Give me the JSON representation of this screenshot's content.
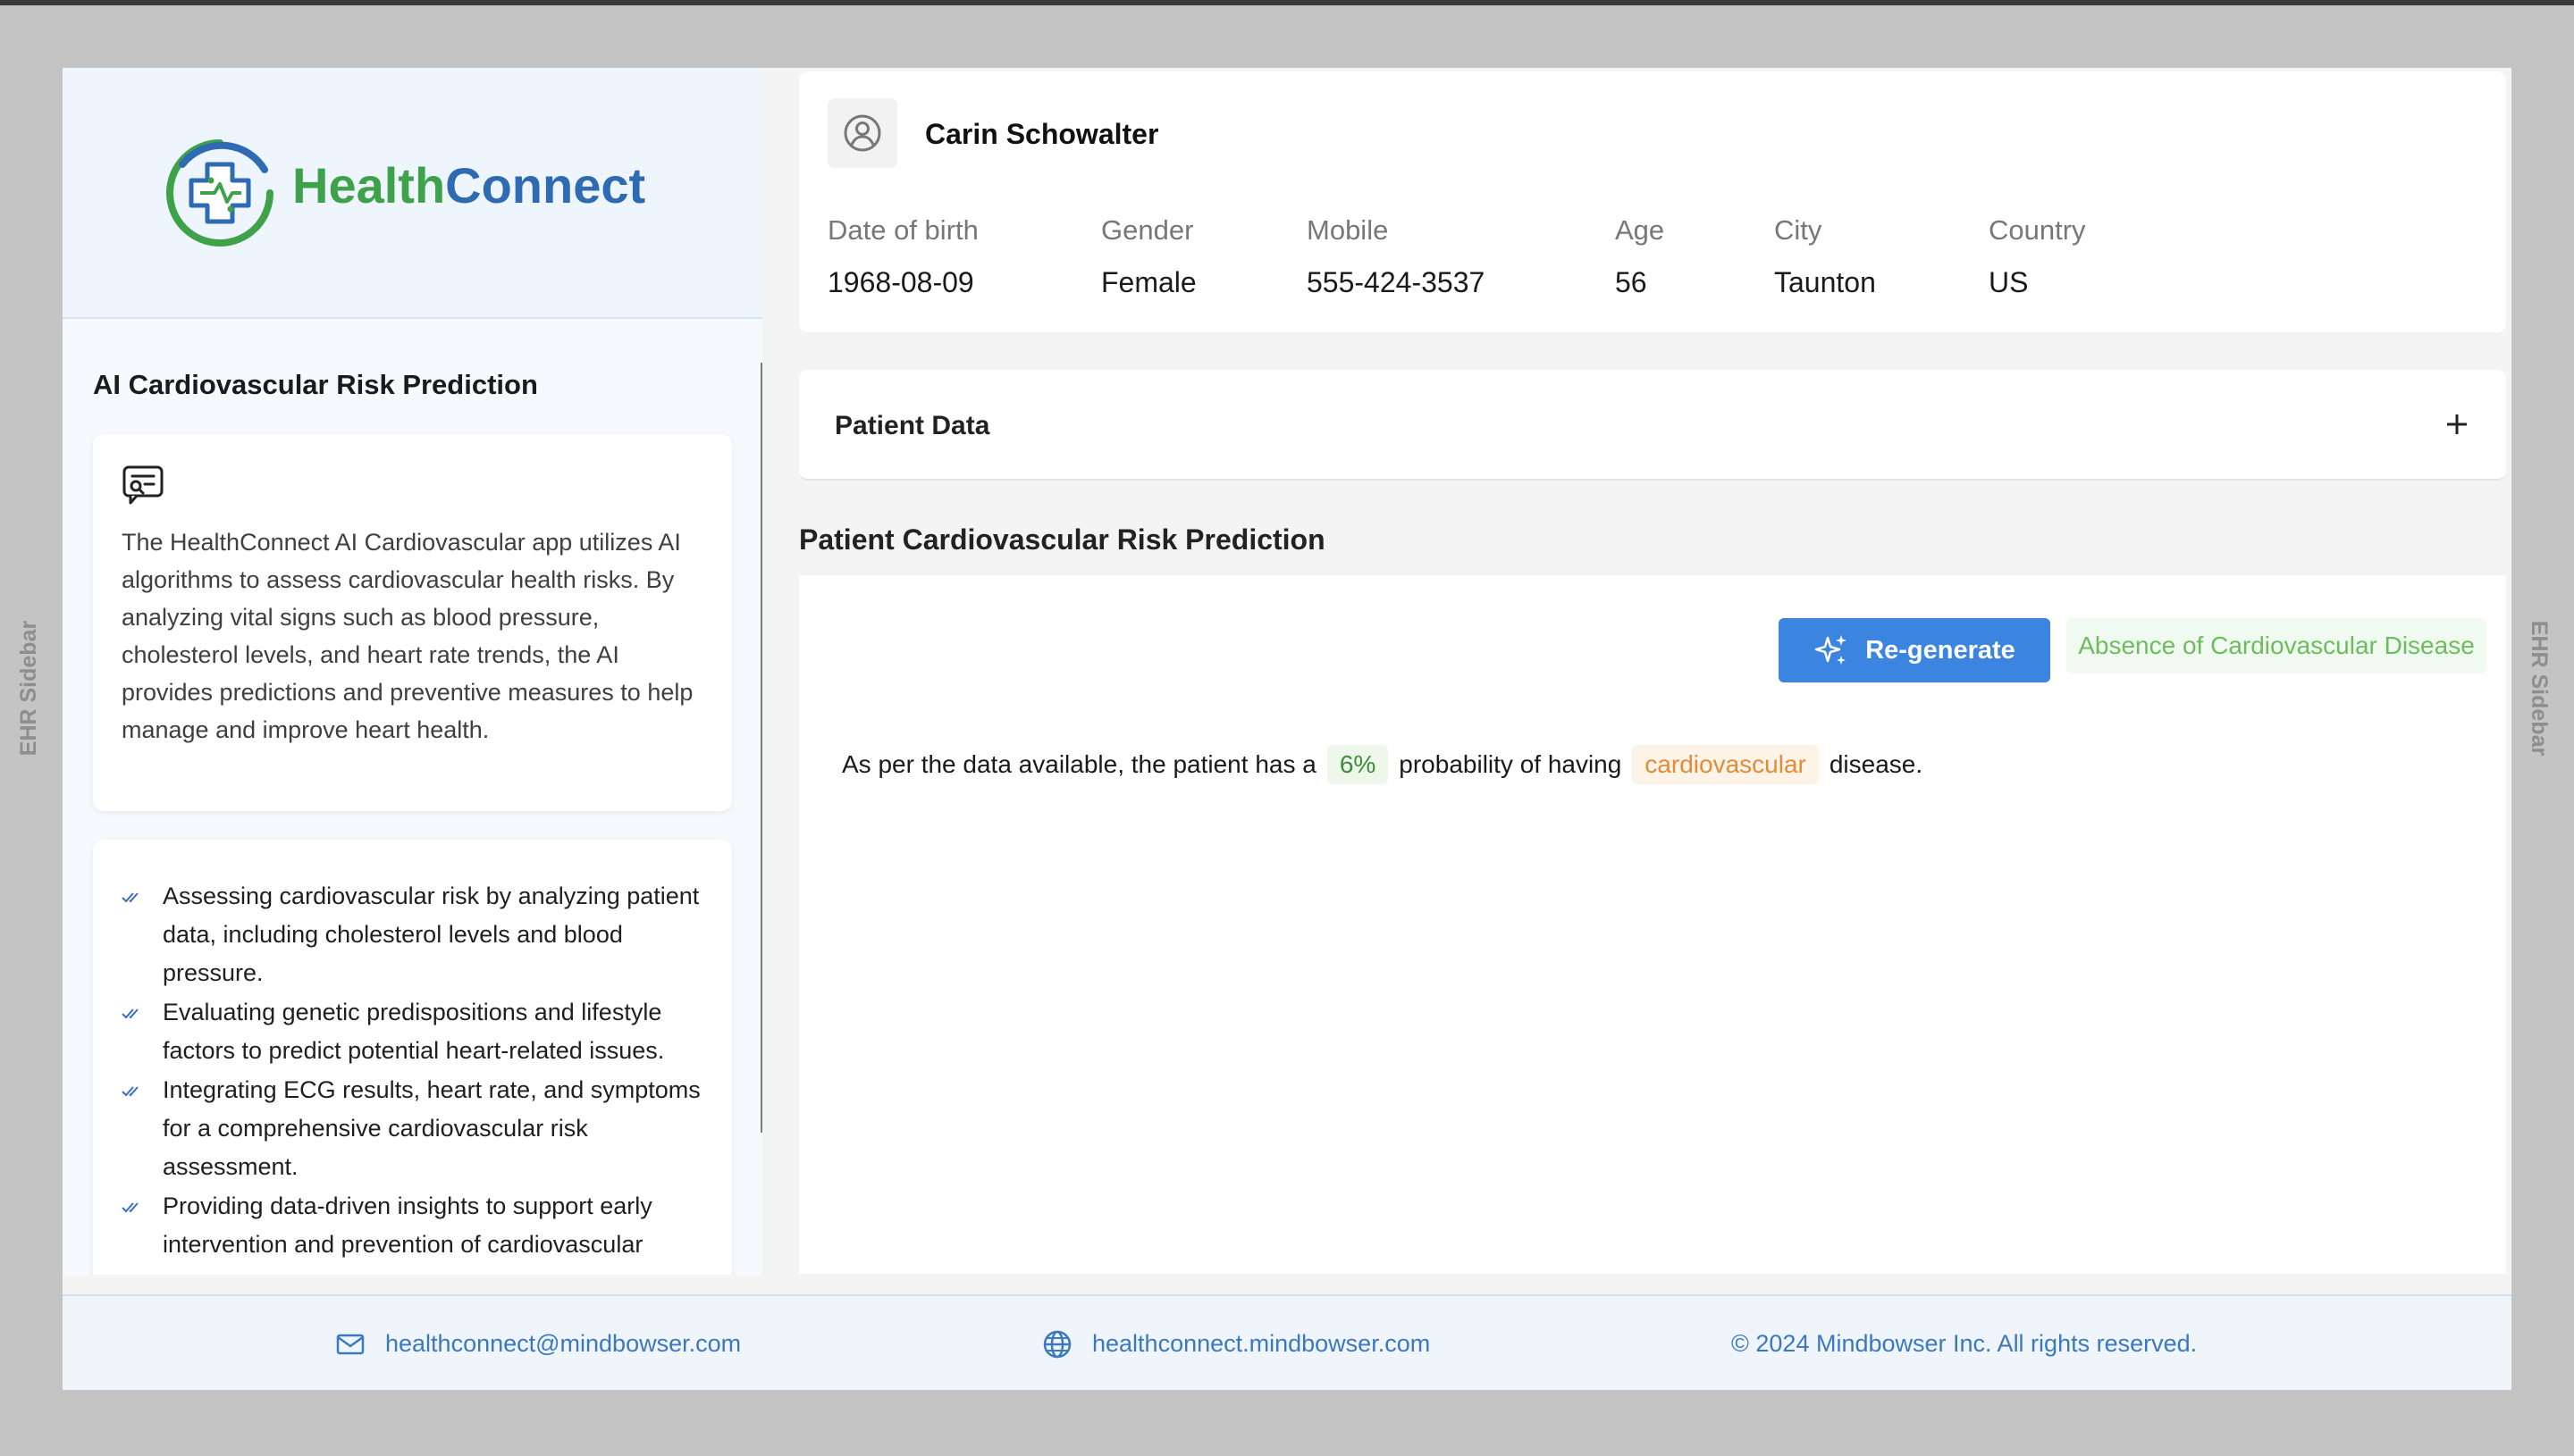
{
  "ehr_sidebar_label": "EHR Sidebar",
  "brand": {
    "name_part1": "Health",
    "name_part2": "Connect",
    "color_green": "#3fa24a",
    "color_blue": "#2f6bb3"
  },
  "left_panel": {
    "title": "AI Cardiovascular Risk Prediction",
    "description": "The HealthConnect AI Cardiovascular app utilizes AI algorithms to assess cardiovascular health risks. By analyzing vital signs such as blood pressure, cholesterol levels, and heart rate trends, the AI provides predictions and preventive measures to help manage and improve heart health.",
    "bullets": [
      "Assessing cardiovascular risk by analyzing patient data, including cholesterol levels and blood pressure.",
      "Evaluating genetic predispositions and lifestyle factors to predict potential heart-related issues.",
      "Integrating ECG results, heart rate, and symptoms for a comprehensive cardiovascular risk assessment.",
      "Providing data-driven insights to support early intervention and prevention of cardiovascular"
    ]
  },
  "patient": {
    "name": "Carin Schowalter",
    "fields": [
      {
        "label": "Date of birth",
        "value": "1968-08-09"
      },
      {
        "label": "Gender",
        "value": "Female"
      },
      {
        "label": "Mobile",
        "value": "555-424-3537"
      },
      {
        "label": "Age",
        "value": "56"
      },
      {
        "label": "City",
        "value": "Taunton"
      },
      {
        "label": "Country",
        "value": "US"
      }
    ]
  },
  "patient_data_section": {
    "label": "Patient Data"
  },
  "risk": {
    "title": "Patient Cardiovascular Risk Prediction",
    "regenerate_label": "Re-generate",
    "result_badge": "Absence of Cardiovascular Disease",
    "sentence_prefix": "As per the data available, the patient has a",
    "probability": "6%",
    "sentence_middle": "probability of having",
    "condition": "cardiovascular",
    "sentence_suffix": "disease.",
    "accent_color": "#3b84e0",
    "positive_color": "#6dbd5e"
  },
  "footer": {
    "email": "healthconnect@mindbowser.com",
    "website": "healthconnect.mindbowser.com",
    "copyright": "© 2024 Mindbowser Inc. All rights reserved."
  }
}
